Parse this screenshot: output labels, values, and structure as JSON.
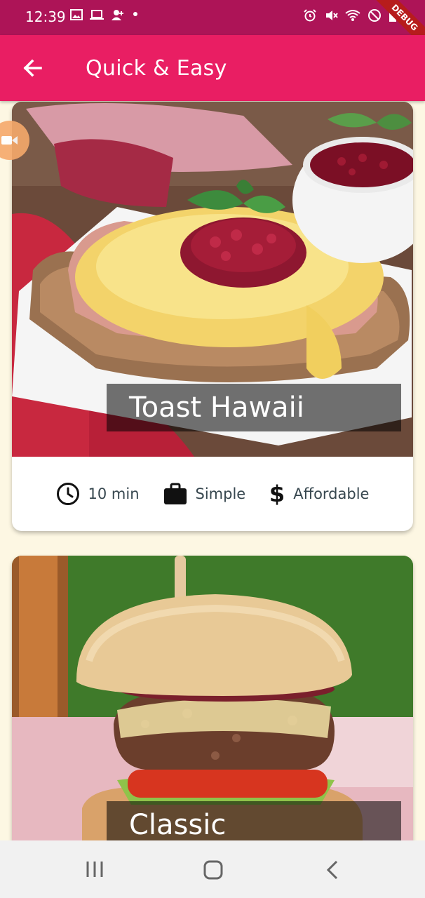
{
  "status_bar": {
    "time": "12:39",
    "left_icons": [
      "image-icon",
      "laptop-icon",
      "person-add-icon",
      "dot-icon"
    ],
    "right_icons": [
      "alarm-icon",
      "mute-icon",
      "wifi-icon",
      "blocked-icon",
      "battery-icon"
    ]
  },
  "debug_banner": "DEBUG",
  "app_bar": {
    "title": "Quick & Easy",
    "back_icon": "arrow-left-icon"
  },
  "meals": [
    {
      "title": "Toast Hawaii",
      "duration": "10 min",
      "complexity": "Simple",
      "affordability": "Affordable"
    },
    {
      "title": "Classic"
    }
  ],
  "colors": {
    "status_bar": "#ad1457",
    "app_bar": "#e91e63",
    "background": "#fdf7e3",
    "card": "#ffffff"
  },
  "nav_bar": {
    "buttons": [
      "recent-apps-icon",
      "home-icon",
      "back-icon"
    ]
  }
}
